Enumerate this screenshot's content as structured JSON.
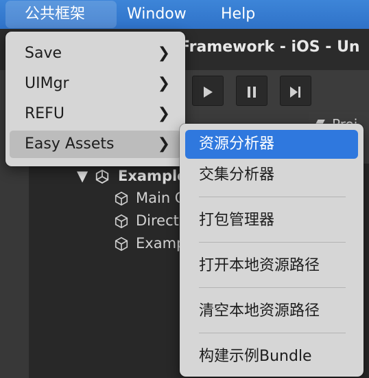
{
  "menubar": {
    "items": [
      {
        "label": "公共框架",
        "active": true
      },
      {
        "label": "Window",
        "active": false
      },
      {
        "label": "Help",
        "active": false
      }
    ]
  },
  "editor": {
    "window_title": "Framework - iOS - Un",
    "playmode_icons": [
      "play-icon",
      "pause-icon",
      "step-icon"
    ],
    "project_tab_label": "Proj",
    "hierarchy": {
      "scene_label": "Example",
      "items": [
        "Main C",
        "Direct",
        "Examp"
      ]
    }
  },
  "menu": {
    "items": [
      {
        "label": "Save"
      },
      {
        "label": "UIMgr"
      },
      {
        "label": "REFU"
      },
      {
        "label": "Easy Assets",
        "highlighted": true
      }
    ]
  },
  "submenu": {
    "items": [
      {
        "label": "资源分析器",
        "selected": true
      },
      {
        "label": "交集分析器"
      },
      {
        "label": "打包管理器"
      },
      {
        "label": "打开本地资源路径"
      },
      {
        "label": "清空本地资源路径"
      },
      {
        "label": "构建示例Bundle"
      }
    ]
  },
  "colors": {
    "menubar_blue": "#2f72c8",
    "menu_bg": "#d6d6d6",
    "selection_blue": "#2f78de",
    "editor_dark": "#282828"
  }
}
